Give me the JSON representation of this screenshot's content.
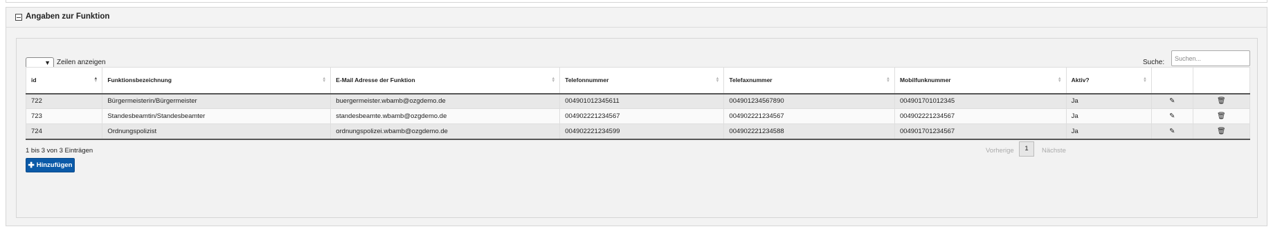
{
  "panel": {
    "title": "Angaben zur Funktion"
  },
  "controls": {
    "length_label": "Zeilen anzeigen",
    "search_label": "Suche:",
    "search_placeholder": "Suchen..."
  },
  "table": {
    "columns": [
      "id",
      "Funktionsbezeichnung",
      "E-Mail Adresse der Funktion",
      "Telefonnummer",
      "Telefaxnummer",
      "Mobilfunknummer",
      "Aktiv?",
      "",
      ""
    ],
    "rows": [
      {
        "id": "722",
        "funktion": "Bürgermeisterin/Bürgermeister",
        "email": "buergermeister.wbamb@ozgdemo.de",
        "telefon": "004901012345611",
        "telefax": "00490123456789​0",
        "mobil": "004901701012345",
        "aktiv": "Ja"
      },
      {
        "id": "723",
        "funktion": "Standesbeamtin/Standesbeamter",
        "email": "standesbeamte.wbamb@ozgdemo.de",
        "telefon": "00490222123456​7",
        "telefax": "004902221234567",
        "mobil": "004902221234567",
        "aktiv": "Ja"
      },
      {
        "id": "724",
        "funktion": "Ordnungspolizist",
        "email": "ordnungspolizei.wbamb@ozgdemo.de",
        "telefon": "004902221234599",
        "telefax": "004902221234588",
        "mobil": "004901701234567",
        "aktiv": "Ja"
      }
    ]
  },
  "footer": {
    "info": "1 bis 3 von 3 Einträgen",
    "prev": "Vorherige",
    "page": "1",
    "next": "Nächste",
    "add_button": "Hinzufügen"
  },
  "icons": {
    "edit": "pencil-icon",
    "delete": "trash-icon",
    "collapse": "minus-square-icon",
    "add": "plus-icon"
  },
  "colors": {
    "primary_button": "#0b5aa8",
    "odd_row": "#e8e8e8"
  }
}
